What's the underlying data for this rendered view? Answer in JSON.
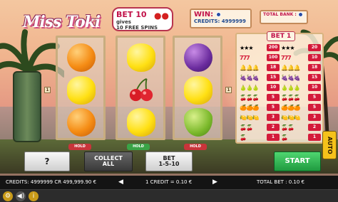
{
  "game": {
    "logo": "Miss Toki",
    "promo": {
      "line1": "BET 10",
      "line2": "gives",
      "line3": "10 FREE SPINS"
    },
    "win_label": "WIN:",
    "credits_label": "CREDITS: 4999999",
    "total_bank_label": "TOTAL BANK :"
  },
  "reels": [
    {
      "symbols": [
        "orange",
        "lemon",
        "orange"
      ],
      "hold": "HOLD",
      "hold_color": "#c9343a"
    },
    {
      "symbols": [
        "lemon",
        "cherry",
        "lemon"
      ],
      "hold": "HOLD",
      "hold_color": "#3aa447"
    },
    {
      "symbols": [
        "plum",
        "lemon",
        "pear"
      ],
      "hold": "HOLD",
      "hold_color": "#c9343a"
    }
  ],
  "line_markers": [
    "1",
    "1"
  ],
  "paytable": {
    "title": "BET 1",
    "rows": [
      {
        "sym": "★★★",
        "v1": "200",
        "v2": "20"
      },
      {
        "sym": "777",
        "v1": "100",
        "v2": "10"
      },
      {
        "sym": "🔔🔔🔔",
        "v1": "18",
        "v2": "18"
      },
      {
        "sym": "🍇🍇🍇",
        "v1": "15",
        "v2": "15"
      },
      {
        "sym": "🍐🍐🍐",
        "v1": "10",
        "v2": "10"
      },
      {
        "sym": "🍒🍒🍒",
        "v1": "5",
        "v2": "5"
      },
      {
        "sym": "🍊🍊🍊",
        "v1": "5",
        "v2": "5"
      },
      {
        "sym": "🍋🍋🍋",
        "v1": "3",
        "v2": "3"
      },
      {
        "sym": "🍒🍒",
        "v1": "2",
        "v2": "2"
      },
      {
        "sym": "🍒",
        "v1": "1",
        "v2": "1"
      }
    ]
  },
  "buttons": {
    "help": "?",
    "collect_all": [
      "COLLECT",
      "ALL"
    ],
    "bet": [
      "BET",
      "1-5-10"
    ],
    "start": "START",
    "auto": "AUTO"
  },
  "status_bar": {
    "credits": "CREDITS: 4999999 CR 499,999.90 €",
    "credit_value": "1 CREDIT = 0.10 €",
    "total_bet": "TOTAL BET : 0.10 €"
  },
  "colors": {
    "accent": "#c2124a",
    "start": "#2fb64f",
    "bar": "#141414"
  }
}
